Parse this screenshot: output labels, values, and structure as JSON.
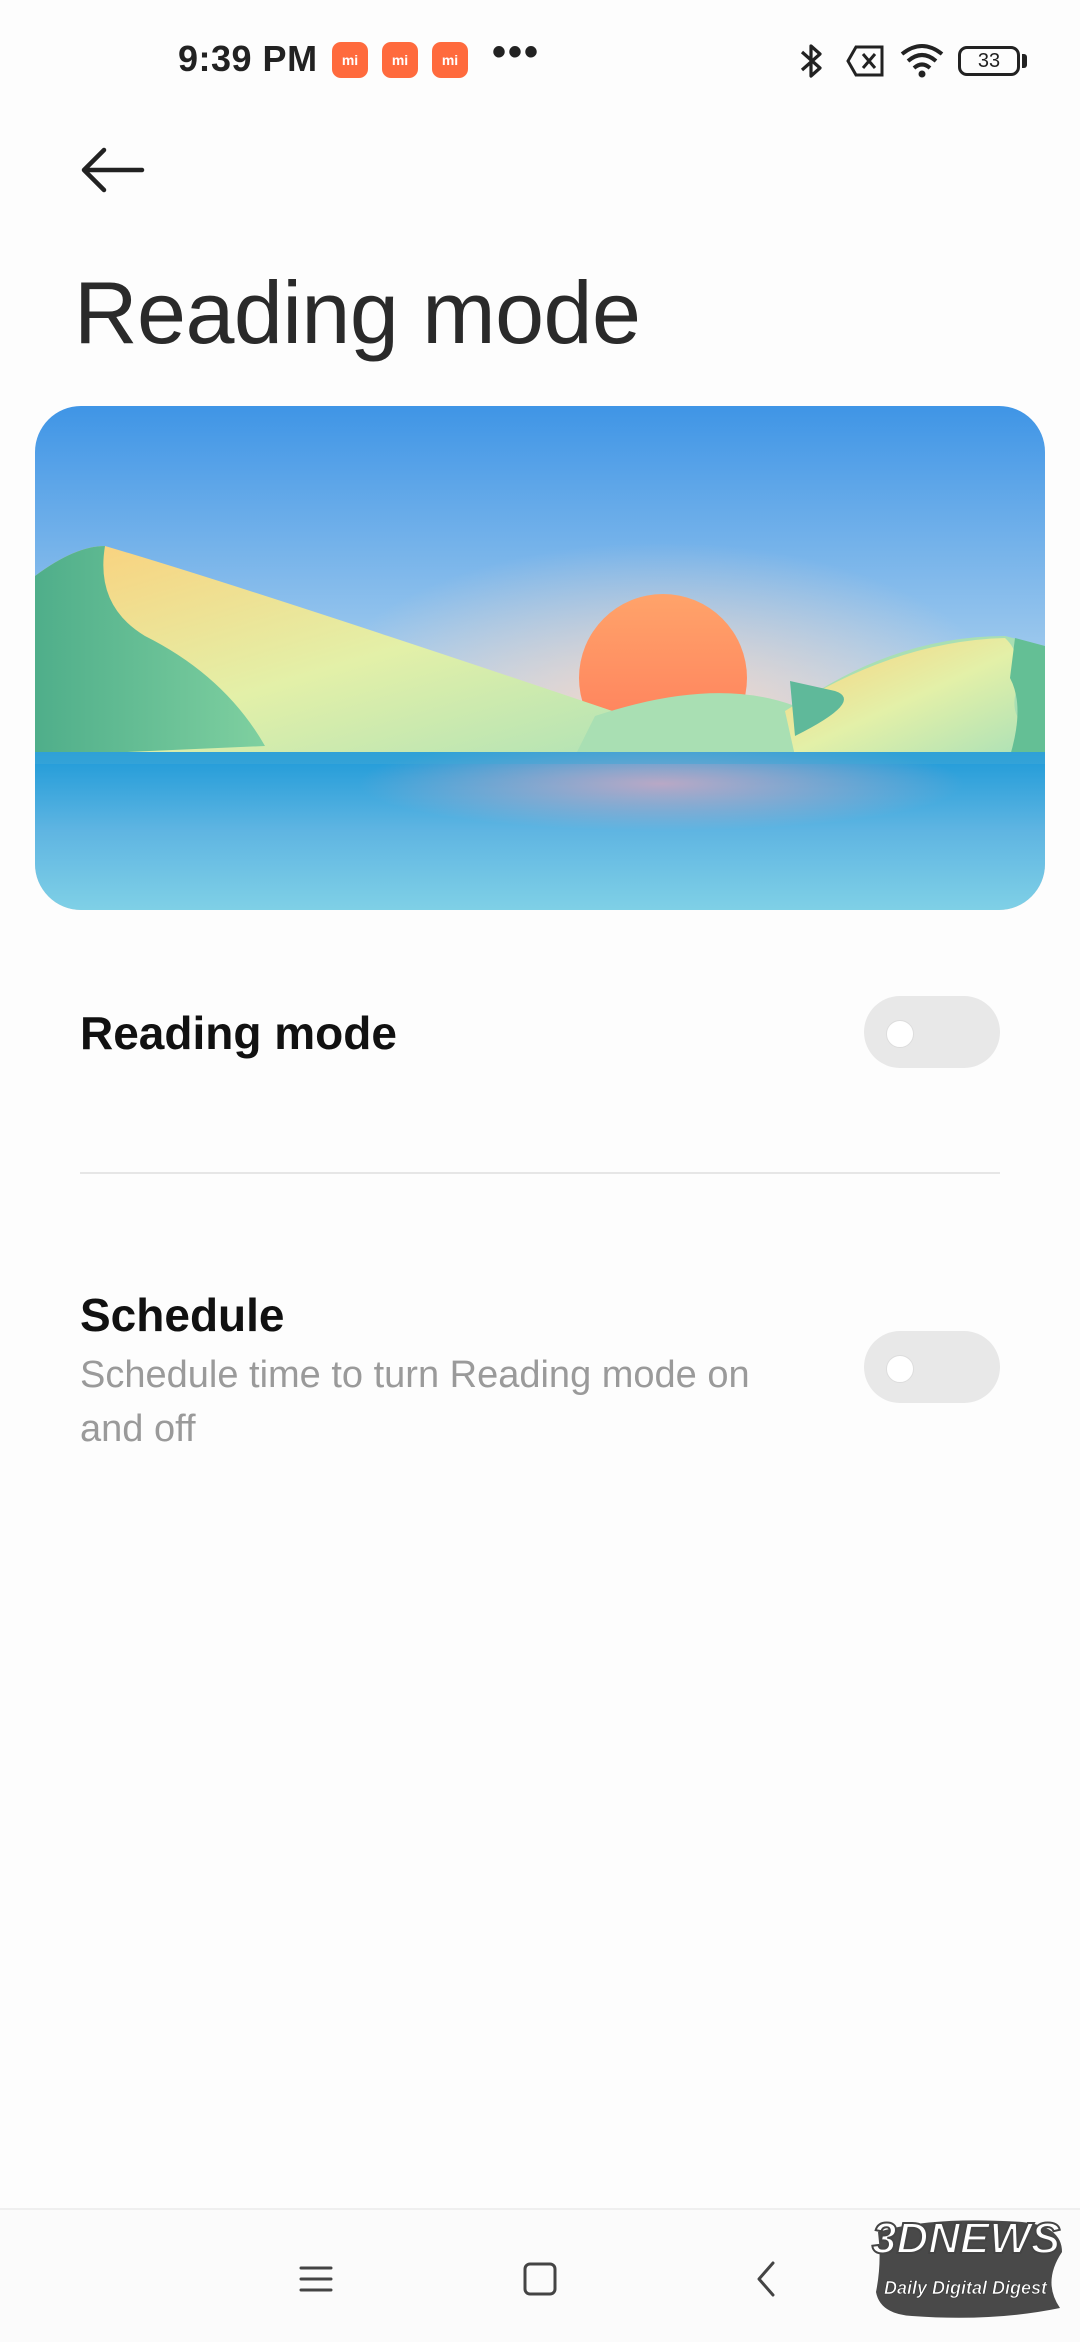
{
  "status_bar": {
    "time": "9:39 PM",
    "app_badges": [
      "mi",
      "mi",
      "mi"
    ],
    "more_indicator": "•••",
    "icons": [
      "bluetooth-icon",
      "sim-error-icon",
      "wifi-icon"
    ],
    "battery_level": "33"
  },
  "header": {
    "back_icon": "arrow-left-icon",
    "title": "Reading mode"
  },
  "settings": {
    "reading_mode": {
      "title": "Reading mode",
      "enabled": false
    },
    "schedule": {
      "title": "Schedule",
      "description": "Schedule time to turn Reading mode on and off",
      "enabled": false
    }
  },
  "nav_bar": {
    "icons": [
      "menu-icon",
      "home-icon",
      "back-icon"
    ]
  },
  "watermark": {
    "brand": "3DNEWS",
    "tagline": "Daily Digital Digest"
  }
}
